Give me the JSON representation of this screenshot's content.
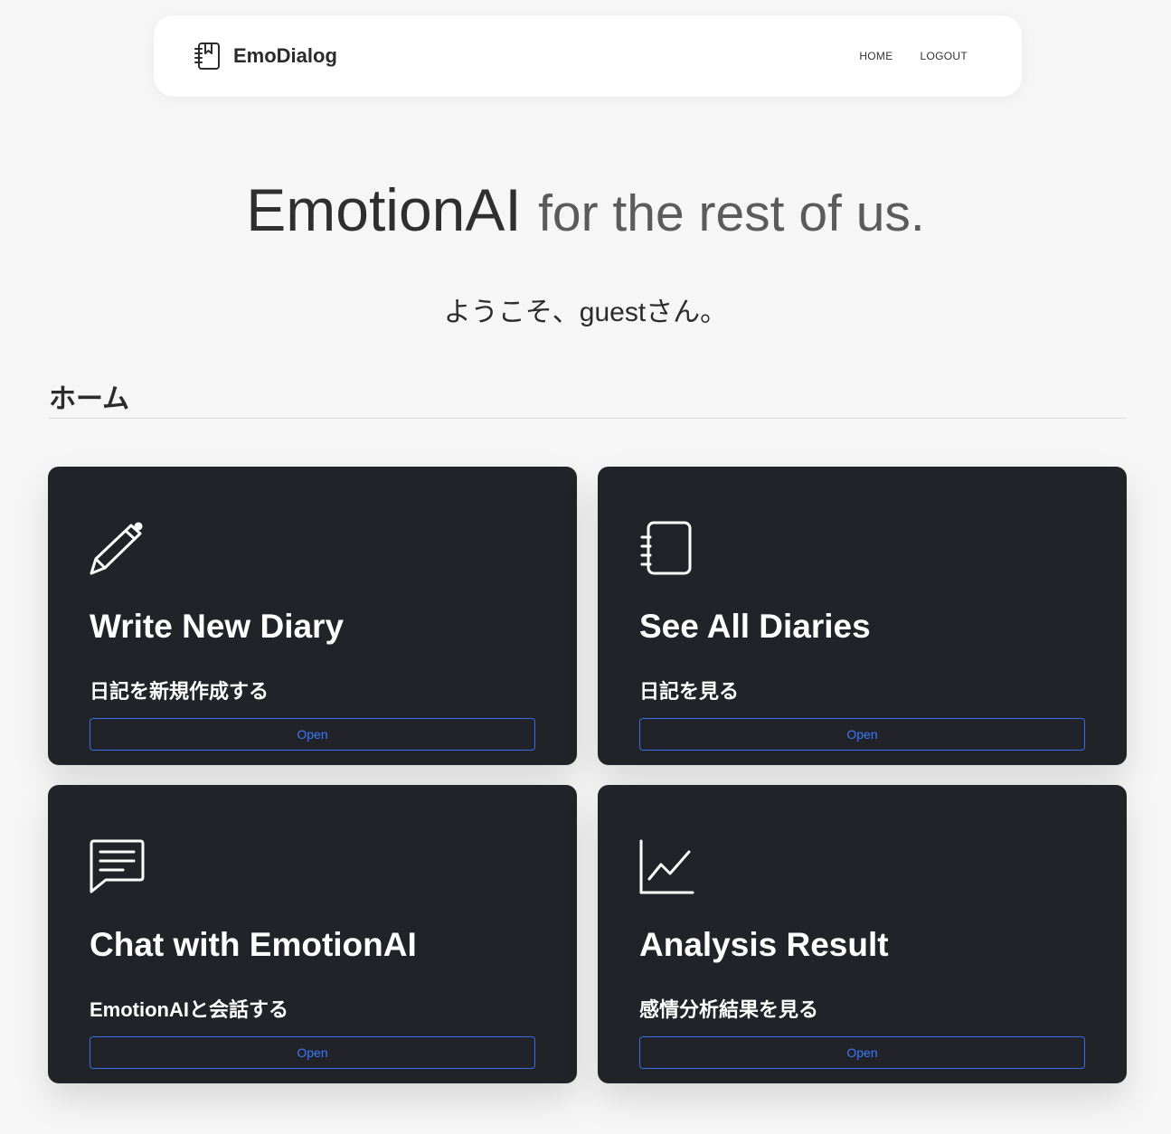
{
  "app": {
    "name": "EmoDialog",
    "brand_icon": "journal-bookmark-icon"
  },
  "nav": {
    "items": [
      {
        "label": "HOME"
      },
      {
        "label": "LOGOUT"
      }
    ]
  },
  "hero": {
    "main": "EmotionAI",
    "sub": "for the rest of us."
  },
  "welcome": "ようこそ、guestさん。",
  "section": {
    "title": "ホーム"
  },
  "theme": {
    "card_bg": "#212328",
    "accent": "#2f6ff0",
    "page_bg": "#f6f6f6"
  },
  "cards": [
    {
      "icon": "pencil-icon",
      "title": "Write New Diary",
      "desc": "日記を新規作成する",
      "button": "Open"
    },
    {
      "icon": "journal-icon",
      "title": "See All Diaries",
      "desc": "日記を見る",
      "button": "Open"
    },
    {
      "icon": "chat-icon",
      "title": "Chat with EmotionAI",
      "desc": "EmotionAIと会話する",
      "button": "Open"
    },
    {
      "icon": "graph-up-icon",
      "title": "Analysis Result",
      "desc": "感情分析結果を見る",
      "button": "Open"
    }
  ]
}
